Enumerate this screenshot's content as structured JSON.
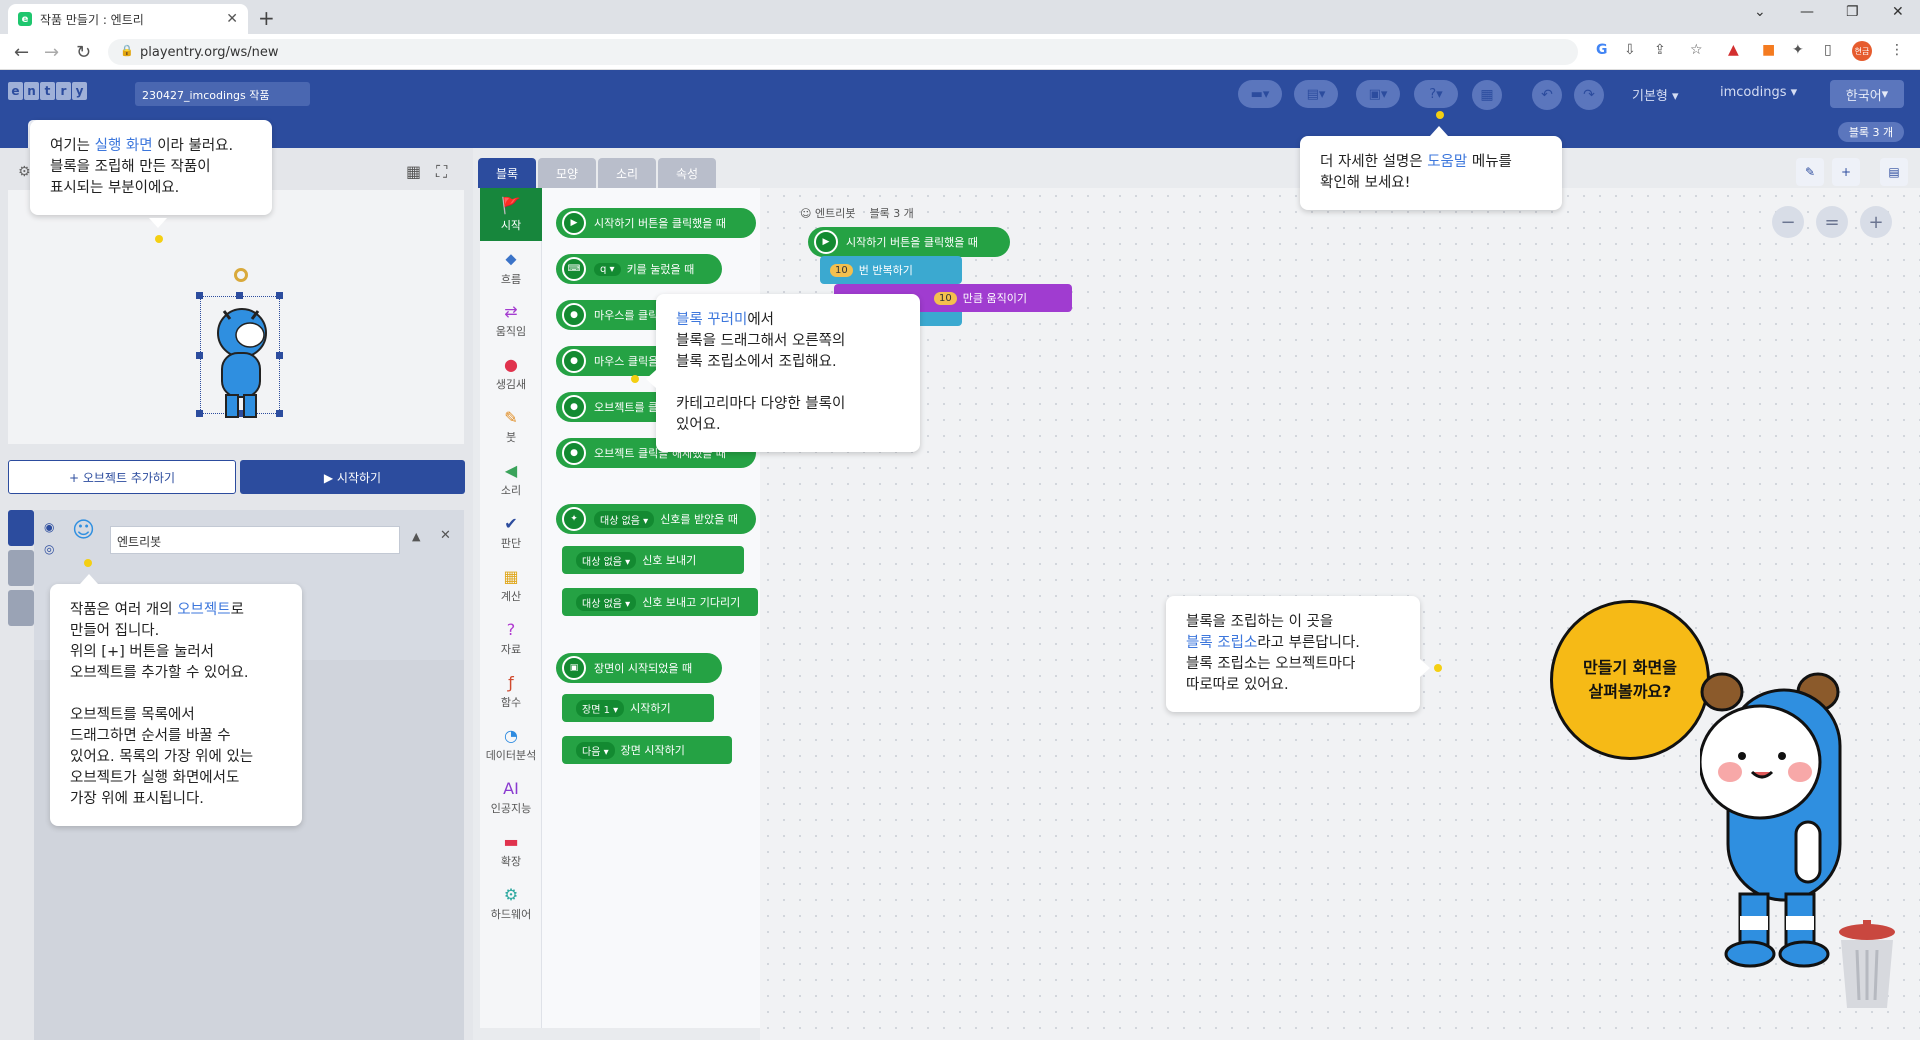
{
  "browser": {
    "tab_title": "작품 만들기 : 엔트리",
    "favicon_letter": "e",
    "url": "playentry.org/ws/new",
    "profile": "현금"
  },
  "header": {
    "logo_letters": [
      "e",
      "n",
      "t",
      "r",
      "y"
    ],
    "project_name": "230427_imcodings 작품",
    "mode": "기본형",
    "user": "imcodings",
    "language": "한국어",
    "block_count": "블록 3 개"
  },
  "stage": {
    "add_object": "+ 오브젝트 추가하기",
    "start": "▶ 시작하기",
    "object_name": "엔트리봇"
  },
  "palette": {
    "tabs": [
      "블록",
      "모양",
      "소리",
      "속성"
    ],
    "categories": [
      {
        "icon": "🚩",
        "label": "시작"
      },
      {
        "icon": "⬥",
        "label": "흐름"
      },
      {
        "icon": "⇄",
        "label": "움직임"
      },
      {
        "icon": "●",
        "label": "생김새"
      },
      {
        "icon": "✎",
        "label": "붓"
      },
      {
        "icon": "◀",
        "label": "소리"
      },
      {
        "icon": "✔",
        "label": "판단"
      },
      {
        "icon": "▦",
        "label": "계산"
      },
      {
        "icon": "?",
        "label": "자료"
      },
      {
        "icon": "ƒ",
        "label": "함수"
      },
      {
        "icon": "◔",
        "label": "데이터분석"
      },
      {
        "icon": "AI",
        "label": "인공지능"
      },
      {
        "icon": "▬",
        "label": "확장"
      },
      {
        "icon": "⚙",
        "label": "하드웨어"
      }
    ],
    "blocks": [
      "시작하기 버튼을 클릭했을 때",
      "키를 눌렀을 때",
      "마우스를 클릭했을 때",
      "마우스 클릭을 해제했을 때",
      "오브젝트를 클릭했을 때",
      "오브젝트 클릭을 해제했을 때",
      "신호를 받았을 때",
      "신호 보내기",
      "신호 보내고 기다리기",
      "장면이 시작되었을 때",
      "시작하기",
      "장면 시작하기"
    ],
    "key_label": "q",
    "target_none": "대상 없음",
    "scene1": "장면 1",
    "next": "다음"
  },
  "workspace": {
    "object_label": "엔트리봇",
    "block_count": "블록 3 개",
    "start_block": "시작하기 버튼을 클릭했을 때",
    "repeat_num": "10",
    "repeat_block": "번 반복하기",
    "move_num": "10",
    "move_block": "만큼 움직이기"
  },
  "tips": {
    "stage_a": "여기는 ",
    "stage_hl": "실행 화면",
    "stage_b": " 이라 불러요.",
    "stage_c": "블록을 조립해 만든 작품이",
    "stage_d": "표시되는 부분이에요.",
    "help_a": "더 자세한 설명은 ",
    "help_hl": "도움말",
    "help_b": " 메뉴를",
    "help_c": "확인해 보세요!",
    "palette_hl": "블록 꾸러미",
    "palette_a": "에서",
    "palette_b": "블록을 드래그해서 오른쪽의",
    "palette_c": "블록 조립소에서 조립해요.",
    "palette_d": "카테고리마다 다양한 블록이",
    "palette_e": "있어요.",
    "object_a": "작품은 여러 개의 ",
    "object_hl": "오브젝트",
    "object_b": "로",
    "object_c": "만들어 집니다.",
    "object_d": "위의 [+] 버튼을 눌러서",
    "object_e": "오브젝트를 추가할 수 있어요.",
    "object_f": "오브젝트를 목록에서",
    "object_g": "드래그하면 순서를 바꿀 수",
    "object_h": "있어요. 목록의 가장 위에 있는",
    "object_i": "오브젝트가 실행 화면에서도",
    "object_j": "가장 위에 표시됩니다.",
    "ws_a": "블록을 조립하는 이 곳을",
    "ws_hl": "블록 조립소",
    "ws_b": "라고 부른답니다.",
    "ws_c": "블록 조립소는 오브젝트마다",
    "ws_d": "따로따로 있어요."
  },
  "mascot": {
    "line1": "만들기 화면을",
    "line2": "살펴볼까요?"
  },
  "colors": {
    "header": "#2c4c9e",
    "block_green": "#25a244",
    "highlight": "#3d77dc",
    "dot": "#f4cf12",
    "speech": "#f6ba16"
  }
}
